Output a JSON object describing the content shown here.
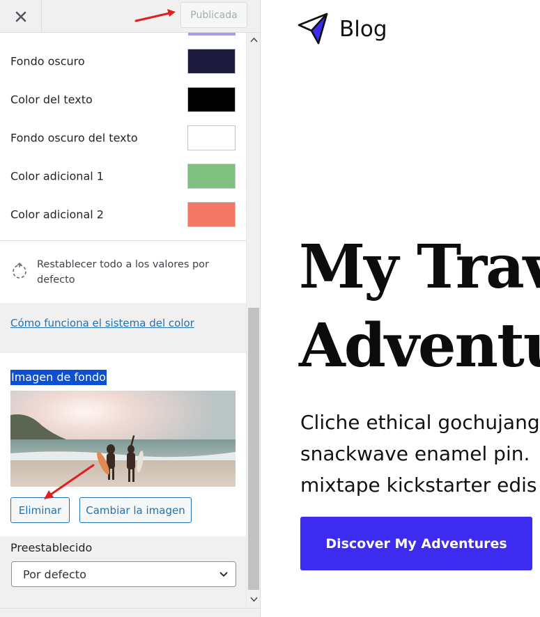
{
  "header": {
    "close_icon": "close-icon",
    "publish_label": "Publicada"
  },
  "colors_panel": {
    "swatches": [
      {
        "label": "Fondo oscuro",
        "color": "#1c1a3d"
      },
      {
        "label": "Color del texto",
        "color": "#000000"
      },
      {
        "label": "Fondo oscuro del texto",
        "color": "#ffffff"
      },
      {
        "label": "Color adicional 1",
        "color": "#7fbf7f"
      },
      {
        "label": "Color adicional 2",
        "color": "#f47866"
      }
    ],
    "top_partial_color": "#a59ee4",
    "reset_label": "Restablecer todo a los valores por defecto",
    "help_link": "Cómo funciona el sistema del color"
  },
  "background_image": {
    "title": "Imagen de fondo",
    "remove_label": "Eliminar",
    "change_label": "Cambiar la imagen"
  },
  "preset": {
    "label": "Preestablecido",
    "selected": "Por defecto"
  },
  "preview": {
    "site_title": "Blog",
    "hero_title_line1": "My Trav",
    "hero_title_line2": "Adventu",
    "hero_text_line1": "Cliche ethical gochujang",
    "hero_text_line2": "snackwave enamel pin. ",
    "hero_text_line3": "mixtape kickstarter edis",
    "cta_label": "Discover My Adventures",
    "accent_color": "#3d2bf0"
  }
}
